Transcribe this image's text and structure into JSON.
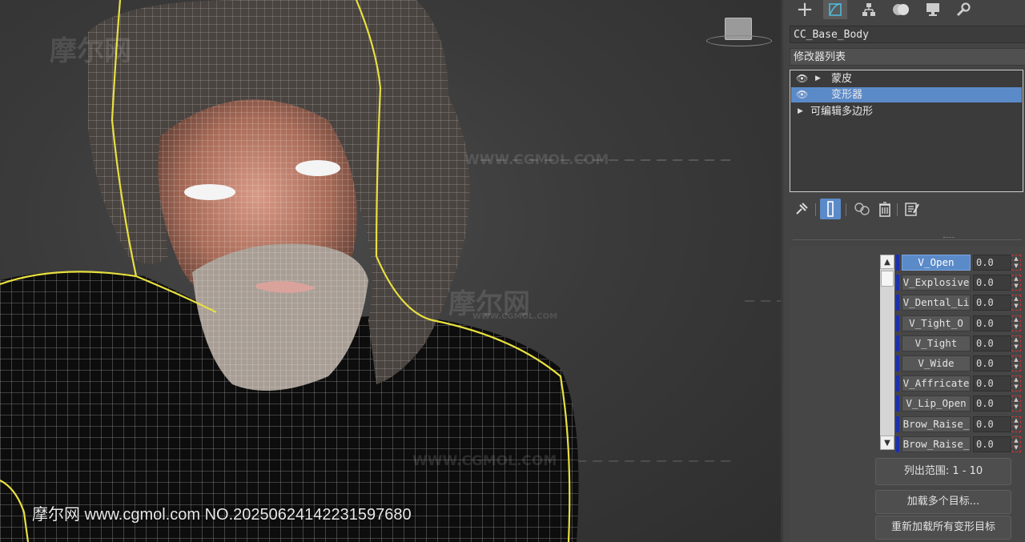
{
  "viewport": {
    "watermark_footer": "摩尔网 www.cgmol.com NO.20250624142231597680",
    "watermark_logo": "摩尔网",
    "watermark_url": "WWW.CGMOL.COM"
  },
  "command_panel": {
    "tabs": [
      {
        "name": "create",
        "icon": "plus-icon"
      },
      {
        "name": "modify",
        "icon": "modify-arc-icon",
        "active": true
      },
      {
        "name": "hierarchy",
        "icon": "hierarchy-icon"
      },
      {
        "name": "motion",
        "icon": "motion-icon"
      },
      {
        "name": "display",
        "icon": "display-monitor-icon"
      },
      {
        "name": "utilities",
        "icon": "wrench-icon"
      }
    ],
    "object_name": "CC_Base_Body",
    "modifier_list_label": "修改器列表",
    "stack": [
      {
        "label": "蒙皮",
        "eye": true,
        "arrow": true,
        "selected": false
      },
      {
        "label": "变形器",
        "eye": true,
        "arrow": false,
        "selected": true
      },
      {
        "label": "可编辑多边形",
        "eye": false,
        "arrow": true,
        "selected": false
      }
    ],
    "stack_tools": [
      "pin-stack-icon",
      "show-end-result-icon",
      "make-unique-icon",
      "remove-modifier-icon",
      "configure-sets-icon"
    ]
  },
  "morpher": {
    "channels": [
      {
        "name": "V_Open",
        "value": "0.0",
        "active": true
      },
      {
        "name": "V_Explosive",
        "value": "0.0"
      },
      {
        "name": "V_Dental_Li",
        "value": "0.0"
      },
      {
        "name": "V_Tight_O",
        "value": "0.0"
      },
      {
        "name": "V_Tight",
        "value": "0.0"
      },
      {
        "name": "V_Wide",
        "value": "0.0"
      },
      {
        "name": "V_Affricate",
        "value": "0.0"
      },
      {
        "name": "V_Lip_Open",
        "value": "0.0"
      },
      {
        "name": "Brow_Raise_",
        "value": "0.0"
      },
      {
        "name": "Brow_Raise_",
        "value": "0.0"
      }
    ],
    "range_label": "列出范围:  1 - 10",
    "load_multiple_label": "加载多个目标...",
    "reload_all_label": "重新加载所有变形目标"
  }
}
